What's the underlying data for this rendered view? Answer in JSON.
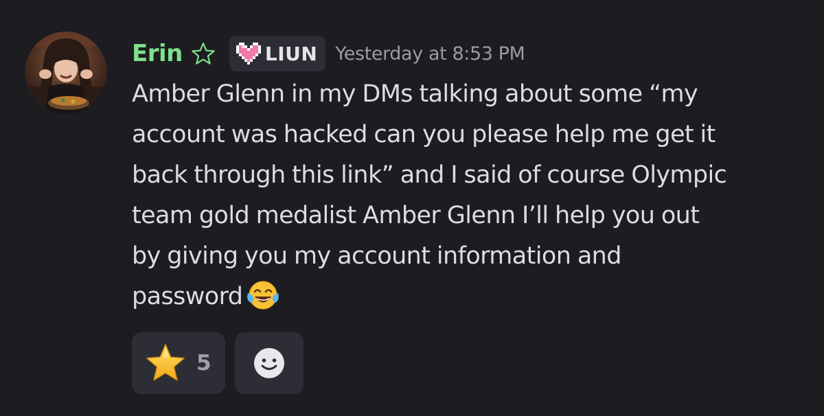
{
  "message": {
    "author": {
      "username": "Erin",
      "avatar": "avatar-photo",
      "username_icon": "star-outline-icon",
      "username_color": "#7ee08a"
    },
    "guild_tag": {
      "icon": "pixel-heart-icon",
      "label": "LIUN"
    },
    "timestamp": "Yesterday at 8:53 PM",
    "content_lines": [
      "Amber Glenn in my DMs talking about some “my",
      "account was hacked can you please help me get it",
      "back through this link” and I said of course Olympic",
      "team gold medalist Amber Glenn I’ll help you out",
      "by giving you my account information and",
      "password"
    ],
    "content_emoji": "face-with-tears-of-joy-emoji",
    "reactions": [
      {
        "emoji": "star-emoji",
        "count": "5"
      }
    ],
    "add_reaction_icon": "add-reaction-smiley-icon"
  },
  "colors": {
    "background": "#1c1c21",
    "chip_background": "#2d2e35",
    "text": "#dcdde1",
    "muted": "#9a9ba3"
  }
}
